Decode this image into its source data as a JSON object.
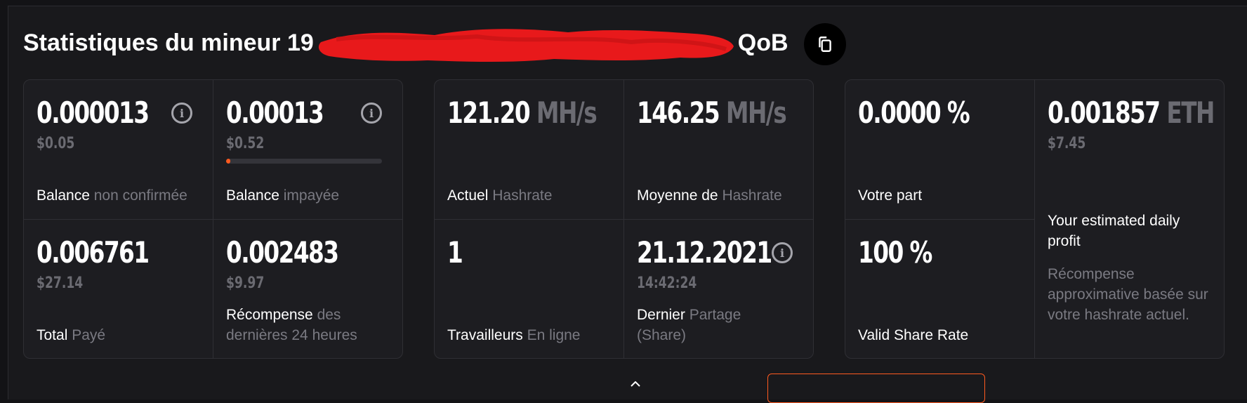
{
  "header": {
    "title_prefix": "Statistiques du mineur 19",
    "title_suffix": "QoB",
    "copy_icon": "copy-icon"
  },
  "balance_panel": {
    "unconfirmed": {
      "value": "0.000013",
      "usd": "$0.05",
      "label": "Balance",
      "label_muted": "non confirmée"
    },
    "unpaid": {
      "value": "0.00013",
      "usd": "$0.52",
      "label": "Balance",
      "label_muted": "impayée",
      "progress_fraction": 0.02
    },
    "total_paid": {
      "value": "0.006761",
      "usd": "$27.14",
      "label": "Total",
      "label_muted": "Payé"
    },
    "reward_24h": {
      "value": "0.002483",
      "usd": "$9.97",
      "label": "Récompense",
      "label_muted": "des dernières 24 heures"
    }
  },
  "hashrate_panel": {
    "current": {
      "value": "121.20",
      "unit": "MH/s",
      "label": "Actuel",
      "label_muted": "Hashrate"
    },
    "average": {
      "value": "146.25",
      "unit": "MH/s",
      "label": "Moyenne de",
      "label_muted": "Hashrate"
    },
    "workers": {
      "value": "1",
      "label": "Travailleurs",
      "label_muted": "En ligne"
    },
    "last_share": {
      "date": "21.12.2021",
      "time": "14:42:24",
      "label": "Dernier",
      "label_muted": "Partage (Share)"
    }
  },
  "share_panel": {
    "your_share": {
      "value": "0.0000 %",
      "label": "Votre part"
    },
    "valid_rate": {
      "value": "100 %",
      "label": "Valid Share Rate"
    },
    "profit": {
      "value": "0.001857",
      "unit": "ETH",
      "usd": "$7.45",
      "label": "Your estimated daily profit",
      "description": "Récompense approximative basée sur votre hashrate actuel."
    }
  },
  "colors": {
    "accent": "#ff5a1f",
    "background": "#19191c",
    "panel": "#1d1d21",
    "muted": "#7a7a82"
  }
}
